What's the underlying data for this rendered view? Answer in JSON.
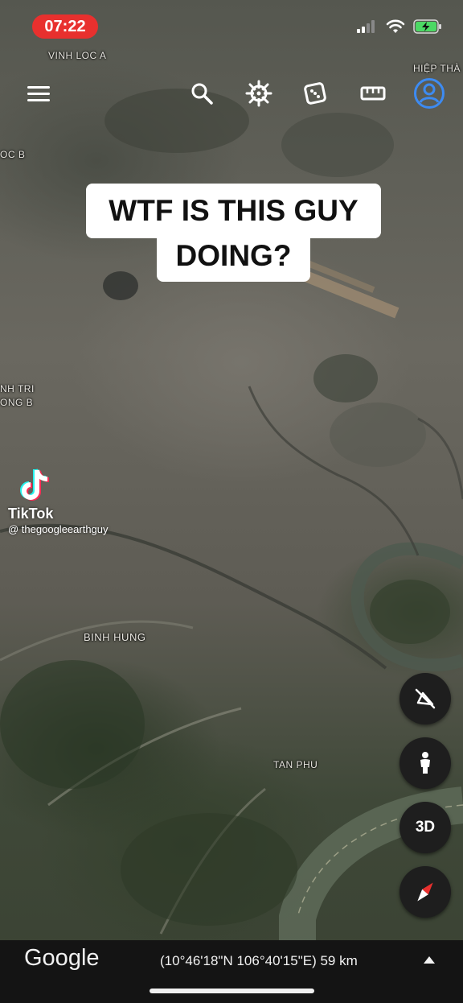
{
  "status_bar": {
    "time": "07:22"
  },
  "map": {
    "places": [
      "VINH LOC A",
      "HIỆP THÀ",
      "OC B",
      "NH TRI",
      "ONG B",
      "BINH HUNG",
      "TAN PHU"
    ]
  },
  "toolbar": {
    "icons": [
      "menu-icon",
      "search-icon",
      "voyager-wheel-icon",
      "dice-icon",
      "ruler-icon",
      "account-icon"
    ],
    "accent_color": "#3d8bf2"
  },
  "caption": {
    "line1": "WTF IS THIS GUY",
    "line2": "DOING?"
  },
  "watermark": {
    "brand": "TikTok",
    "handle": "@ thegoogleearthguy"
  },
  "controls": {
    "three_d_label": "3D",
    "icons": [
      "no-gravity-icon",
      "pegman-icon",
      "compass-icon"
    ]
  },
  "bottom_bar": {
    "logo": "Google",
    "coordinates": "(10°46'18\"N 106°40'15\"E) 59 km",
    "expand_icon": "triangle-up-icon"
  }
}
